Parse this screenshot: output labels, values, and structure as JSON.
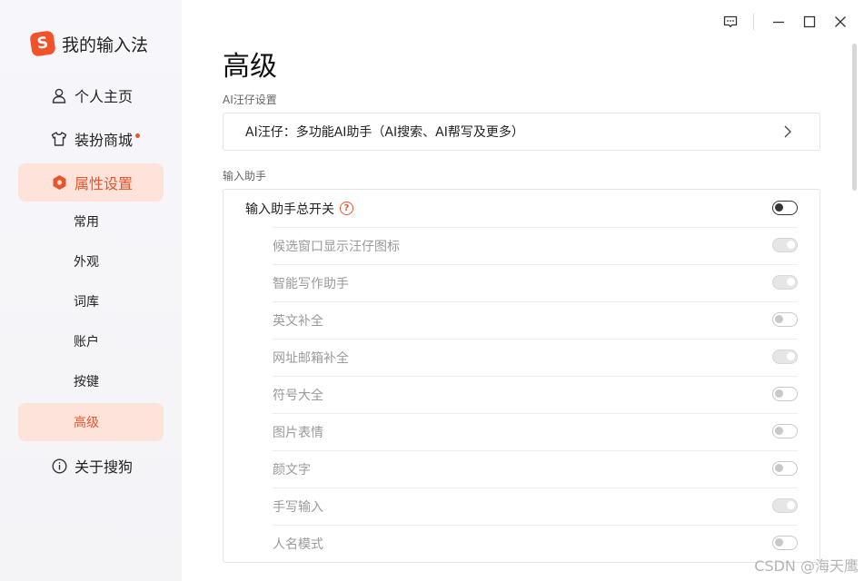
{
  "app": {
    "name": "我的输入法",
    "logo_letter": "S",
    "accent": "#e8542c"
  },
  "sidebar": {
    "items": [
      {
        "label": "个人主页",
        "icon": "person-icon"
      },
      {
        "label": "装扮商城",
        "icon": "shirt-icon",
        "has_badge": true
      },
      {
        "label": "属性设置",
        "icon": "hexagon-settings-icon",
        "active": true
      },
      {
        "label": "关于搜狗",
        "icon": "info-icon"
      }
    ],
    "sub_items": [
      {
        "label": "常用"
      },
      {
        "label": "外观"
      },
      {
        "label": "词库"
      },
      {
        "label": "账户"
      },
      {
        "label": "按键"
      },
      {
        "label": "高级",
        "active": true
      }
    ]
  },
  "page": {
    "title": "高级",
    "ai_section_label": "AI汪仔设置",
    "ai_card_text": "AI汪仔：多功能AI助手（AI搜索、AI帮写及更多）",
    "helper_section_label": "输入助手",
    "helper_main": {
      "label": "输入助手总开关",
      "help": "?",
      "toggle": "off"
    },
    "helper_items": [
      {
        "label": "候选窗口显示汪仔图标",
        "toggle": "on"
      },
      {
        "label": "智能写作助手",
        "toggle": "on"
      },
      {
        "label": "英文补全",
        "toggle": "off"
      },
      {
        "label": "网址邮箱补全",
        "toggle": "on"
      },
      {
        "label": "符号大全",
        "toggle": "off"
      },
      {
        "label": "图片表情",
        "toggle": "off"
      },
      {
        "label": "颜文字",
        "toggle": "off"
      },
      {
        "label": "手写输入",
        "toggle": "on"
      },
      {
        "label": "人名模式",
        "toggle": "off"
      }
    ]
  },
  "window_controls": [
    "feedback-icon",
    "minimize-icon",
    "maximize-icon",
    "close-icon"
  ],
  "watermark": "CSDN @海天鹰"
}
